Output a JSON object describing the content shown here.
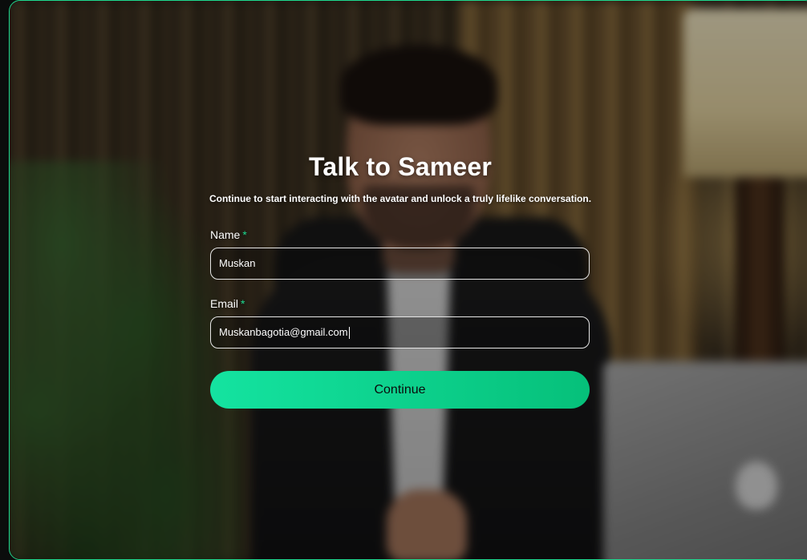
{
  "form": {
    "title": "Talk to Sameer",
    "subtitle": "Continue to start interacting with the avatar and unlock a truly lifelike conversation.",
    "name_label": "Name",
    "name_required": "*",
    "name_value": "Muskan",
    "email_label": "Email",
    "email_required": "*",
    "email_value": "Muskanbagotia@gmail.com",
    "continue_label": "Continue"
  },
  "colors": {
    "accent": "#1ed98f",
    "button_start": "#14e3a0",
    "button_end": "#06c07a"
  }
}
